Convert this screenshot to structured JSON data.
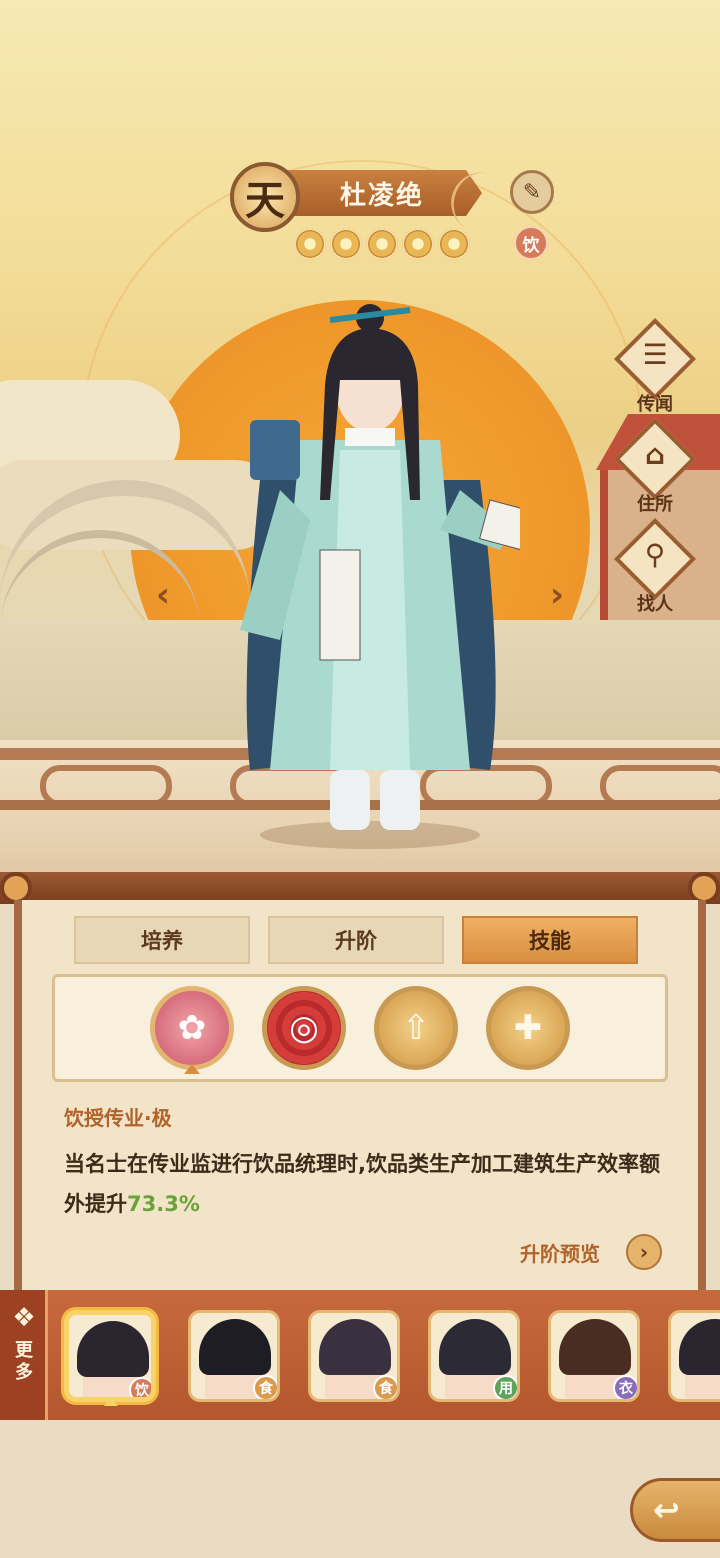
{
  "header": {
    "rank_glyph": "天",
    "name": "杜凌绝",
    "stars": 5,
    "category_badge": "饮",
    "brush_icon": "brush-icon"
  },
  "side_buttons": [
    {
      "label": "传闻",
      "icon": "scroll-icon",
      "glyph": "☰"
    },
    {
      "label": "住所",
      "icon": "house-icon",
      "glyph": "⌂"
    },
    {
      "label": "找人",
      "icon": "search-person-icon",
      "glyph": "⚲"
    }
  ],
  "nav": {
    "prev": "‹",
    "next": "›"
  },
  "tabs": [
    {
      "label": "培养",
      "active": false
    },
    {
      "label": "升阶",
      "active": false
    },
    {
      "label": "技能",
      "active": true
    }
  ],
  "skills": [
    {
      "name": "drink-skill-icon",
      "glyph": "✿",
      "selected": true
    },
    {
      "name": "target-skill-icon",
      "glyph": "◎",
      "selected": false
    },
    {
      "name": "building-up-icon",
      "glyph": "⇧",
      "selected": false
    },
    {
      "name": "building-plus-icon",
      "glyph": "✚",
      "selected": false
    }
  ],
  "skill_detail": {
    "title": "饮授传业·极",
    "desc_part1": "当名士在传业监进行饮品统理时,饮品类生产加工建筑生产效率额外提升",
    "value": "73.3%",
    "preview_label": "升阶预览"
  },
  "roster": {
    "more_label": "更多",
    "cards": [
      {
        "tag": "饮",
        "tag_color": "#d67b5a",
        "selected": true
      },
      {
        "tag": "食",
        "tag_color": "#d99a4a",
        "selected": false
      },
      {
        "tag": "食",
        "tag_color": "#d99a4a",
        "selected": false
      },
      {
        "tag": "用",
        "tag_color": "#5fa35b",
        "selected": false
      },
      {
        "tag": "衣",
        "tag_color": "#8a6cb8",
        "selected": false
      },
      {
        "tag": "",
        "tag_color": "#d99a4a",
        "selected": false
      }
    ]
  },
  "back_icon": "back-icon"
}
